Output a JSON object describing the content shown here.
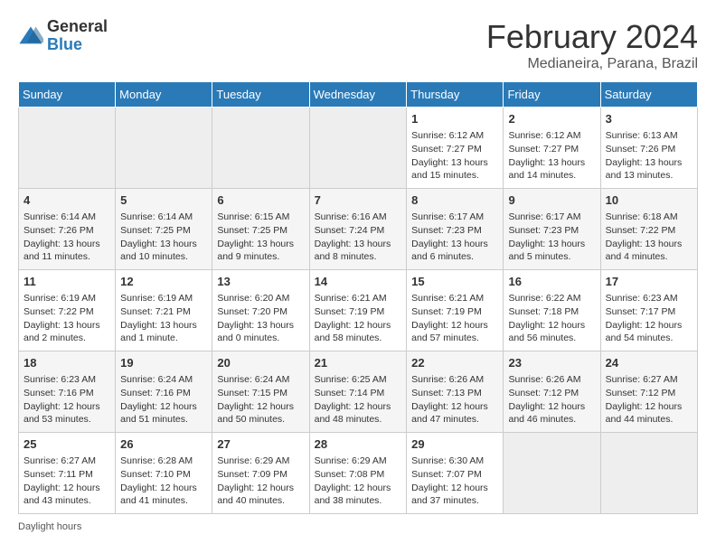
{
  "logo": {
    "general": "General",
    "blue": "Blue"
  },
  "header": {
    "month": "February 2024",
    "location": "Medianeira, Parana, Brazil"
  },
  "weekdays": [
    "Sunday",
    "Monday",
    "Tuesday",
    "Wednesday",
    "Thursday",
    "Friday",
    "Saturday"
  ],
  "days": {
    "d1": {
      "num": "1",
      "sunrise": "Sunrise: 6:12 AM",
      "sunset": "Sunset: 7:27 PM",
      "daylight": "Daylight: 13 hours and 15 minutes."
    },
    "d2": {
      "num": "2",
      "sunrise": "Sunrise: 6:12 AM",
      "sunset": "Sunset: 7:27 PM",
      "daylight": "Daylight: 13 hours and 14 minutes."
    },
    "d3": {
      "num": "3",
      "sunrise": "Sunrise: 6:13 AM",
      "sunset": "Sunset: 7:26 PM",
      "daylight": "Daylight: 13 hours and 13 minutes."
    },
    "d4": {
      "num": "4",
      "sunrise": "Sunrise: 6:14 AM",
      "sunset": "Sunset: 7:26 PM",
      "daylight": "Daylight: 13 hours and 11 minutes."
    },
    "d5": {
      "num": "5",
      "sunrise": "Sunrise: 6:14 AM",
      "sunset": "Sunset: 7:25 PM",
      "daylight": "Daylight: 13 hours and 10 minutes."
    },
    "d6": {
      "num": "6",
      "sunrise": "Sunrise: 6:15 AM",
      "sunset": "Sunset: 7:25 PM",
      "daylight": "Daylight: 13 hours and 9 minutes."
    },
    "d7": {
      "num": "7",
      "sunrise": "Sunrise: 6:16 AM",
      "sunset": "Sunset: 7:24 PM",
      "daylight": "Daylight: 13 hours and 8 minutes."
    },
    "d8": {
      "num": "8",
      "sunrise": "Sunrise: 6:17 AM",
      "sunset": "Sunset: 7:23 PM",
      "daylight": "Daylight: 13 hours and 6 minutes."
    },
    "d9": {
      "num": "9",
      "sunrise": "Sunrise: 6:17 AM",
      "sunset": "Sunset: 7:23 PM",
      "daylight": "Daylight: 13 hours and 5 minutes."
    },
    "d10": {
      "num": "10",
      "sunrise": "Sunrise: 6:18 AM",
      "sunset": "Sunset: 7:22 PM",
      "daylight": "Daylight: 13 hours and 4 minutes."
    },
    "d11": {
      "num": "11",
      "sunrise": "Sunrise: 6:19 AM",
      "sunset": "Sunset: 7:22 PM",
      "daylight": "Daylight: 13 hours and 2 minutes."
    },
    "d12": {
      "num": "12",
      "sunrise": "Sunrise: 6:19 AM",
      "sunset": "Sunset: 7:21 PM",
      "daylight": "Daylight: 13 hours and 1 minute."
    },
    "d13": {
      "num": "13",
      "sunrise": "Sunrise: 6:20 AM",
      "sunset": "Sunset: 7:20 PM",
      "daylight": "Daylight: 13 hours and 0 minutes."
    },
    "d14": {
      "num": "14",
      "sunrise": "Sunrise: 6:21 AM",
      "sunset": "Sunset: 7:19 PM",
      "daylight": "Daylight: 12 hours and 58 minutes."
    },
    "d15": {
      "num": "15",
      "sunrise": "Sunrise: 6:21 AM",
      "sunset": "Sunset: 7:19 PM",
      "daylight": "Daylight: 12 hours and 57 minutes."
    },
    "d16": {
      "num": "16",
      "sunrise": "Sunrise: 6:22 AM",
      "sunset": "Sunset: 7:18 PM",
      "daylight": "Daylight: 12 hours and 56 minutes."
    },
    "d17": {
      "num": "17",
      "sunrise": "Sunrise: 6:23 AM",
      "sunset": "Sunset: 7:17 PM",
      "daylight": "Daylight: 12 hours and 54 minutes."
    },
    "d18": {
      "num": "18",
      "sunrise": "Sunrise: 6:23 AM",
      "sunset": "Sunset: 7:16 PM",
      "daylight": "Daylight: 12 hours and 53 minutes."
    },
    "d19": {
      "num": "19",
      "sunrise": "Sunrise: 6:24 AM",
      "sunset": "Sunset: 7:16 PM",
      "daylight": "Daylight: 12 hours and 51 minutes."
    },
    "d20": {
      "num": "20",
      "sunrise": "Sunrise: 6:24 AM",
      "sunset": "Sunset: 7:15 PM",
      "daylight": "Daylight: 12 hours and 50 minutes."
    },
    "d21": {
      "num": "21",
      "sunrise": "Sunrise: 6:25 AM",
      "sunset": "Sunset: 7:14 PM",
      "daylight": "Daylight: 12 hours and 48 minutes."
    },
    "d22": {
      "num": "22",
      "sunrise": "Sunrise: 6:26 AM",
      "sunset": "Sunset: 7:13 PM",
      "daylight": "Daylight: 12 hours and 47 minutes."
    },
    "d23": {
      "num": "23",
      "sunrise": "Sunrise: 6:26 AM",
      "sunset": "Sunset: 7:12 PM",
      "daylight": "Daylight: 12 hours and 46 minutes."
    },
    "d24": {
      "num": "24",
      "sunrise": "Sunrise: 6:27 AM",
      "sunset": "Sunset: 7:12 PM",
      "daylight": "Daylight: 12 hours and 44 minutes."
    },
    "d25": {
      "num": "25",
      "sunrise": "Sunrise: 6:27 AM",
      "sunset": "Sunset: 7:11 PM",
      "daylight": "Daylight: 12 hours and 43 minutes."
    },
    "d26": {
      "num": "26",
      "sunrise": "Sunrise: 6:28 AM",
      "sunset": "Sunset: 7:10 PM",
      "daylight": "Daylight: 12 hours and 41 minutes."
    },
    "d27": {
      "num": "27",
      "sunrise": "Sunrise: 6:29 AM",
      "sunset": "Sunset: 7:09 PM",
      "daylight": "Daylight: 12 hours and 40 minutes."
    },
    "d28": {
      "num": "28",
      "sunrise": "Sunrise: 6:29 AM",
      "sunset": "Sunset: 7:08 PM",
      "daylight": "Daylight: 12 hours and 38 minutes."
    },
    "d29": {
      "num": "29",
      "sunrise": "Sunrise: 6:30 AM",
      "sunset": "Sunset: 7:07 PM",
      "daylight": "Daylight: 12 hours and 37 minutes."
    }
  },
  "footer": {
    "daylight_label": "Daylight hours"
  }
}
